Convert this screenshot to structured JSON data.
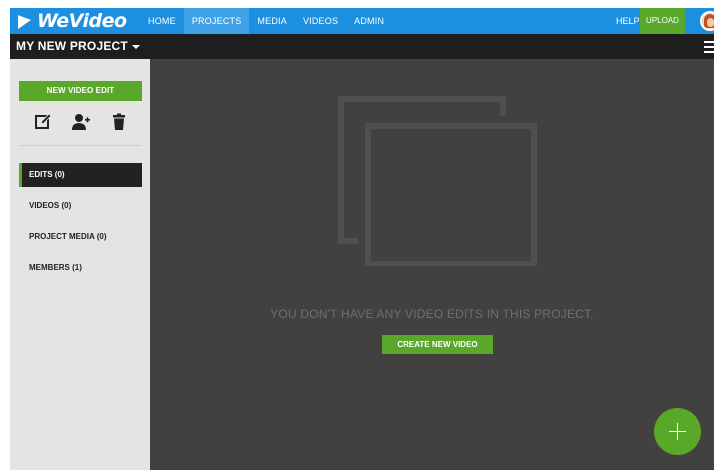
{
  "topnav": {
    "logo": "WeVideo",
    "links": [
      {
        "label": "HOME"
      },
      {
        "label": "PROJECTS"
      },
      {
        "label": "MEDIA"
      },
      {
        "label": "VIDEOS"
      },
      {
        "label": "ADMIN"
      }
    ],
    "help": "HELP",
    "upload": "UPLOAD"
  },
  "project": {
    "title": "MY NEW PROJECT"
  },
  "sidebar": {
    "new_edit": "NEW VIDEO EDIT",
    "tools": [
      "edit-icon",
      "add-member-icon",
      "trash-icon"
    ],
    "items": [
      {
        "label": "EDITS (0)"
      },
      {
        "label": "VIDEOS (0)"
      },
      {
        "label": "PROJECT MEDIA (0)"
      },
      {
        "label": "MEMBERS (1)"
      }
    ]
  },
  "main": {
    "empty_message": "YOU DON'T HAVE ANY VIDEO EDITS IN THIS PROJECT.",
    "create_button": "CREATE NEW VIDEO"
  },
  "colors": {
    "brand_blue": "#1d8fe1",
    "green": "#5aa82a",
    "dark_bar": "#1e1e1e",
    "main_bg": "#414141",
    "sidebar_bg": "#e4e4e4"
  }
}
